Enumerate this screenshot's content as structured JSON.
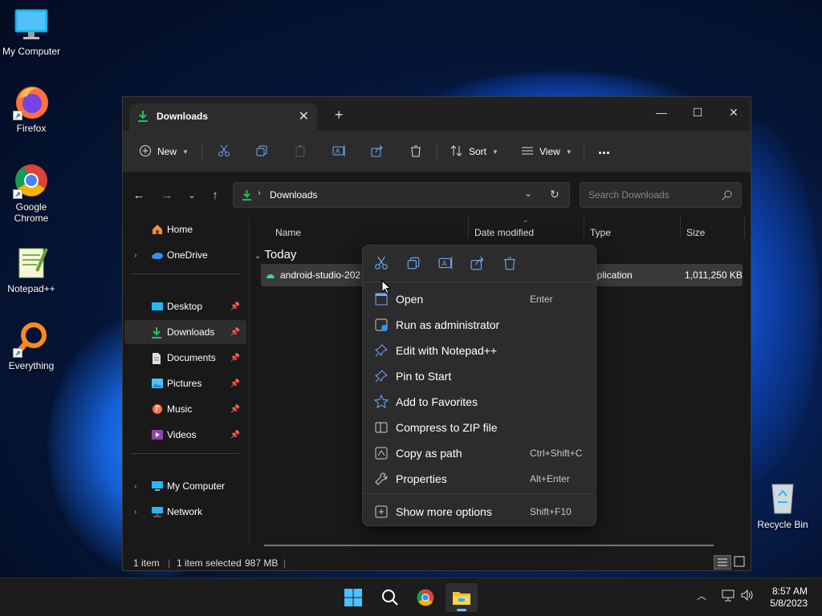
{
  "desktop": {
    "icons": [
      {
        "label": "My Computer"
      },
      {
        "label": "Firefox"
      },
      {
        "label": "Google Chrome"
      },
      {
        "label": "Notepad++"
      },
      {
        "label": "Everything"
      },
      {
        "label": "Recycle Bin"
      }
    ]
  },
  "window": {
    "tab_title": "Downloads",
    "toolbar": {
      "new_label": "New",
      "sort_label": "Sort",
      "view_label": "View",
      "more_label": "..."
    },
    "address": {
      "path": "Downloads",
      "search_placeholder": "Search Downloads"
    },
    "sidebar": {
      "items": [
        {
          "label": "Home",
          "icon": "home-icon"
        },
        {
          "label": "OneDrive",
          "icon": "cloud-icon"
        },
        {
          "label": "Desktop",
          "icon": "desktop-folder-icon"
        },
        {
          "label": "Downloads",
          "icon": "download-icon"
        },
        {
          "label": "Documents",
          "icon": "document-icon"
        },
        {
          "label": "Pictures",
          "icon": "picture-icon"
        },
        {
          "label": "Music",
          "icon": "music-icon"
        },
        {
          "label": "Videos",
          "icon": "video-icon"
        },
        {
          "label": "My Computer",
          "icon": "computer-icon"
        },
        {
          "label": "Network",
          "icon": "network-icon"
        }
      ]
    },
    "columns": [
      "Name",
      "Date modified",
      "Type",
      "Size"
    ],
    "group_label": "Today",
    "rows": [
      {
        "name": "android-studio-202",
        "type": "pplication",
        "size": "1,011,250 KB"
      }
    ],
    "status": {
      "items": "1 item",
      "selected": "1 item selected",
      "size": "987 MB"
    }
  },
  "context_menu": {
    "quick_actions": [
      "cut-icon",
      "copy-icon",
      "rename-icon",
      "share-icon",
      "delete-icon"
    ],
    "items": [
      {
        "label": "Open",
        "shortcut": "Enter"
      },
      {
        "label": "Run as administrator",
        "shortcut": ""
      },
      {
        "label": "Edit with Notepad++",
        "shortcut": ""
      },
      {
        "label": "Pin to Start",
        "shortcut": ""
      },
      {
        "label": "Add to Favorites",
        "shortcut": ""
      },
      {
        "label": "Compress to ZIP file",
        "shortcut": ""
      },
      {
        "label": "Copy as path",
        "shortcut": "Ctrl+Shift+C"
      },
      {
        "label": "Properties",
        "shortcut": "Alt+Enter"
      },
      {
        "label": "Show more options",
        "shortcut": "Shift+F10"
      }
    ]
  },
  "taskbar": {
    "clock_time": "8:57 AM",
    "clock_date": "5/8/2023"
  },
  "colors": {
    "accent": "#0f9d58",
    "selection": "#3a3a3a",
    "taskbar_indicator": "#7db8ff"
  }
}
